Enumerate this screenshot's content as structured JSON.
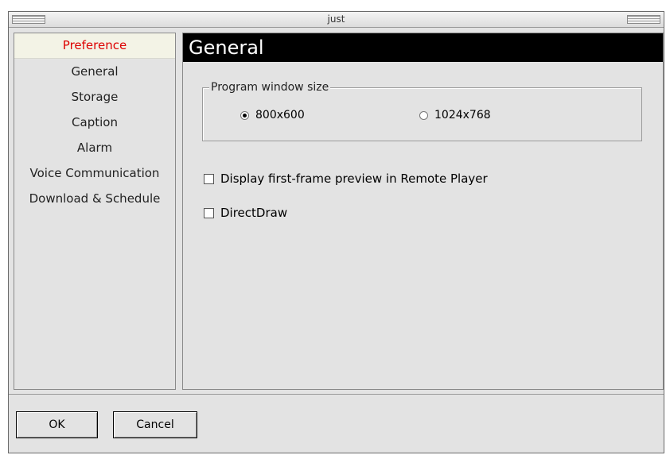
{
  "window": {
    "title": "just"
  },
  "sidebar": {
    "items": [
      {
        "label": "Preference",
        "active": true
      },
      {
        "label": "General"
      },
      {
        "label": "Storage"
      },
      {
        "label": "Caption"
      },
      {
        "label": "Alarm"
      },
      {
        "label": "Voice Communication"
      },
      {
        "label": "Download & Schedule"
      }
    ]
  },
  "main": {
    "header": "General",
    "window_size": {
      "legend": "Program window size",
      "options": [
        {
          "label": "800x600",
          "selected": true
        },
        {
          "label": "1024x768",
          "selected": false
        }
      ]
    },
    "checkboxes": [
      {
        "label": "Display first-frame preview in Remote Player",
        "checked": false
      },
      {
        "label": "DirectDraw",
        "checked": false
      }
    ]
  },
  "footer": {
    "ok_label": "OK",
    "cancel_label": "Cancel"
  },
  "colors": {
    "accent_red": "#dd0000",
    "header_bg": "#000000",
    "panel_bg": "#e3e3e3"
  }
}
